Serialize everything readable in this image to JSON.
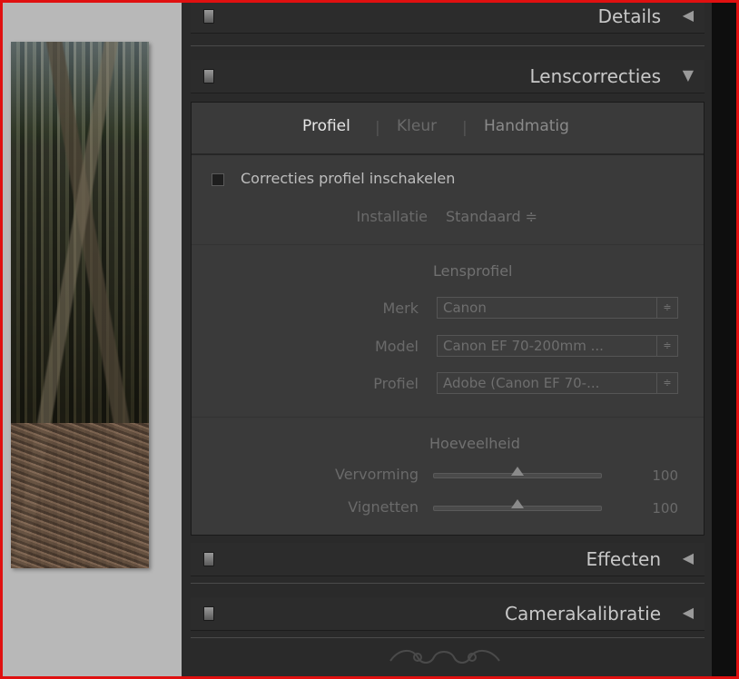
{
  "sections": {
    "details": {
      "title": "Details",
      "arrow": "◀"
    },
    "lens": {
      "title": "Lenscorrecties",
      "arrow": "▼"
    },
    "effects": {
      "title": "Effecten",
      "arrow": "◀"
    },
    "calibration": {
      "title": "Camerakalibratie",
      "arrow": "◀"
    }
  },
  "lens_tabs": [
    {
      "label": "Profiel",
      "active": true
    },
    {
      "label": "Kleur",
      "active": false
    },
    {
      "label": "Handmatig",
      "active": false
    }
  ],
  "lens_panel": {
    "enable_profile_label": "Correcties profiel inschakelen",
    "enable_profile_checked": false,
    "setup_label": "Installatie",
    "setup_value": "Standaard ≑",
    "lens_profile_heading": "Lensprofiel",
    "make_label": "Merk",
    "make_value": "Canon",
    "model_label": "Model",
    "model_value": "Canon EF 70-200mm ...",
    "profile_label": "Profiel",
    "profile_value": "Adobe (Canon EF 70-...",
    "amount_heading": "Hoeveelheid",
    "distortion_label": "Vervorming",
    "distortion_value": "100",
    "vignetting_label": "Vignetten",
    "vignetting_value": "100"
  },
  "colors": {
    "highlight_border": "#e01010",
    "panel_bg": "#2a2a2a",
    "section_bg": "#3a3a3a"
  }
}
